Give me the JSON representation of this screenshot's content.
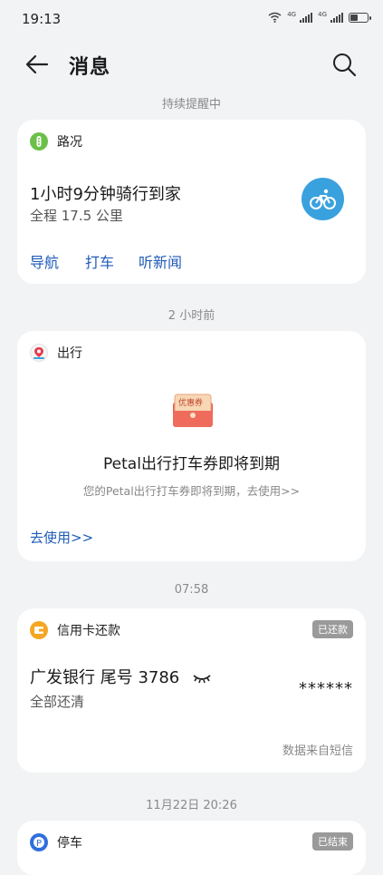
{
  "status_bar": {
    "time": "19:13",
    "network_1": "4G",
    "network_2": "4G",
    "battery_percent": 45
  },
  "header": {
    "title": "消息",
    "back_icon": "arrow-left-icon",
    "search_icon": "search-icon"
  },
  "sections": [
    {
      "label": "持续提醒中"
    },
    {
      "label": "2 小时前"
    },
    {
      "label": "07:58"
    },
    {
      "label": "11月22日 20:26"
    }
  ],
  "traffic_card": {
    "app": "路况",
    "headline": "1小时9分钟骑行到家",
    "detail": "全程 17.5 公里",
    "actions": [
      "导航",
      "打车",
      "听新闻"
    ],
    "icon": "bicycle-icon",
    "accent": "#3aa1df"
  },
  "travel_card": {
    "app": "出行",
    "coupon_label": "优惠券",
    "title": "Petal出行打车券即将到期",
    "subtitle": "您的Petal出行打车券即将到期，去使用>>",
    "action": "去使用>>"
  },
  "credit_card": {
    "app": "信用卡还款",
    "badge": "已还款",
    "bank": "广发银行 尾号 3786",
    "status": "全部还清",
    "amount_masked": "******",
    "source": "数据来自短信"
  },
  "parking_card": {
    "app": "停车",
    "badge": "已结束"
  },
  "colors": {
    "background": "#f1f3f5",
    "link": "#1f5bb7",
    "badge": "#9a9a9a"
  }
}
